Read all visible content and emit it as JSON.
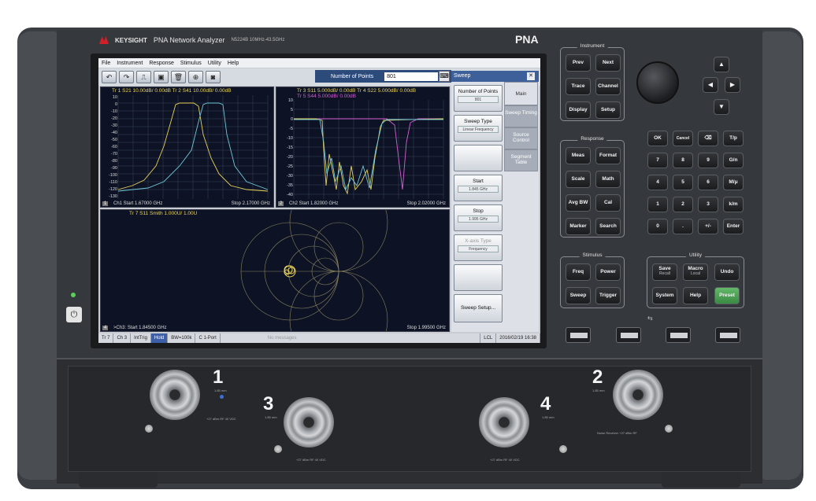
{
  "brand": {
    "name": "KEYSIGHT",
    "title": "PNA Network Analyzer",
    "model": "N5224B 10MHz-43.5GHz",
    "badge": "PNA"
  },
  "menu": [
    "File",
    "Instrument",
    "Response",
    "Stimulus",
    "Utility",
    "Help"
  ],
  "toolbar": {
    "icons": [
      "undo-icon",
      "redo-icon",
      "marker-icon",
      "save-icon",
      "delete-icon",
      "zoom-icon",
      "camera-icon"
    ],
    "glyphs": [
      "↶",
      "↷",
      "⎍",
      "▣",
      "🗑",
      "⊕",
      "◙"
    ],
    "nop_label": "Number of Points",
    "nop_value": "801",
    "kbd": "⌨"
  },
  "trace1": {
    "title": "Tr 1  S21 10.00dB/ 0.00dB   Tr 2  S41 10.00dB/ 0.00dB",
    "start": "Ch1  Start  1.67000 GHz",
    "stop": "Stop  2.17000 GHz",
    "num": "1",
    "ylabels": [
      "10",
      "0",
      "-10",
      "-20",
      "-30",
      "-40",
      "-50",
      "-60",
      "-70",
      "-80",
      "-90",
      "-100",
      "-110",
      "-120",
      "-130"
    ]
  },
  "trace2": {
    "title": "Tr 3  S11 5.000dB/ 0.00dB   Tr 4  S22 5.000dB/ 0.00dB",
    "title2": "Tr 5  S44 5.000dB/ 0.00dB",
    "start": "Ch2  Start  1.82000 GHz",
    "stop": "Stop  2.02000 GHz",
    "num": "2",
    "ylabels": [
      "10",
      "5",
      "0",
      "-5",
      "-10",
      "-15",
      "-20",
      "-25",
      "-30",
      "-35",
      "-40"
    ]
  },
  "trace3": {
    "title": "Tr 7  S11 Smith 1.000U/ 1.00U",
    "start": ">Ch3:  Start  1.84500 GHz",
    "stop": "Stop  1.99500 GHz",
    "num": "4"
  },
  "sweep": {
    "header": "Sweep",
    "close": "✕",
    "buttons": [
      {
        "label": "Number of Points",
        "value": "801"
      },
      {
        "label": "Sweep Type",
        "value": "Linear Frequency"
      },
      {
        "label": "",
        "value": ""
      },
      {
        "label": "Start",
        "value": "1.845 GHz"
      },
      {
        "label": "Stop",
        "value": "1.995 GHz"
      },
      {
        "label": "X-axis Type",
        "value": "Frequency"
      },
      {
        "label": "",
        "value": ""
      },
      {
        "label": "Sweep Setup...",
        "value": ""
      }
    ],
    "tabs": [
      "Main",
      "Sweep Timing",
      "Source Control",
      "Segment Table"
    ]
  },
  "status": [
    "Tr 7",
    "Ch 3",
    "IntTrig",
    "Hold",
    "BW=100k",
    "C  1-Port",
    "No messages",
    "LCL",
    "2016/02/19 16:38"
  ],
  "groups": {
    "instrument": "Instrument",
    "response": "Response",
    "stimulus": "Stimulus",
    "utility": "Utility"
  },
  "instrument_keys": [
    "Prev",
    "Next",
    "Trace",
    "Channel",
    "Display",
    "Setup"
  ],
  "response_keys": [
    "Meas",
    "Format",
    "Scale",
    "Math",
    "Avg BW",
    "Cal",
    "Marker",
    "Search"
  ],
  "stimulus_keys": [
    "Freq",
    "Power",
    "Sweep",
    "Trigger"
  ],
  "utility_keys": [
    {
      "a": "Save",
      "b": "Recall"
    },
    {
      "a": "Macro",
      "b": "Local"
    },
    {
      "a": "Undo",
      "b": ""
    },
    {
      "a": "System",
      "b": ""
    },
    {
      "a": "Help",
      "b": ""
    },
    {
      "a": "Preset",
      "b": ""
    }
  ],
  "numpad": [
    "OK",
    "Cancel",
    "⌫",
    "T/p",
    "7",
    "8",
    "9",
    "G/n",
    "4",
    "5",
    "6",
    "M/μ",
    "1",
    "2",
    "3",
    "k/m",
    "0",
    ".",
    "+/-",
    "Enter"
  ],
  "arrows": [
    "▲",
    "◀",
    "▶",
    "▼"
  ],
  "power": "⏻",
  "usb_symbol": "⇆",
  "ports": [
    "1",
    "2",
    "3",
    "4"
  ],
  "port_notes": [
    "1.85 mm",
    "+27 dBm RF 40 VDC",
    "Noise Receiver +27 dBm RF"
  ]
}
